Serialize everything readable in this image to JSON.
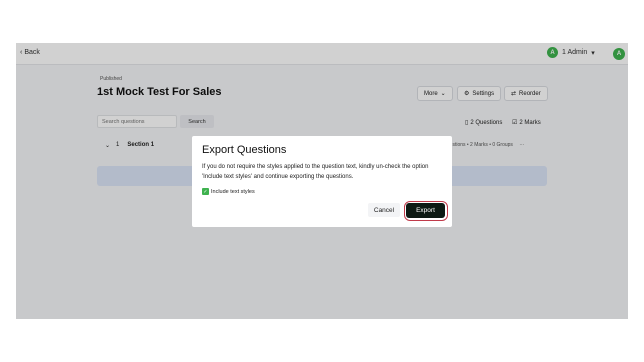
{
  "topbar": {
    "back_label": "Back",
    "user_initial": "A",
    "user_label": "1 Admin",
    "avatar_initial": "A"
  },
  "test": {
    "status": "Published",
    "title": "1st Mock Test For Sales"
  },
  "toolbar": {
    "more_label": "More",
    "settings_label": "Settings",
    "reorder_label": "Reorder"
  },
  "search": {
    "placeholder": "Search questions",
    "button_label": "Search"
  },
  "stats": {
    "questions": "2 Questions",
    "marks": "2 Marks"
  },
  "section": {
    "number": "1",
    "name": "Section 1",
    "meta": "Questions • 2 Marks • 0 Groups"
  },
  "dialog": {
    "title": "Export Questions",
    "body": "If you do not require the styles applied to the question text, kindly un-check the option 'Include text styles' and continue exporting the questions.",
    "checkbox_label": "Include text styles",
    "checkbox_checked": true,
    "cancel_label": "Cancel",
    "export_label": "Export"
  },
  "colors": {
    "accent": "#3fb24f",
    "export_button": "#0d1a14",
    "highlight_ring": "#c03a4a"
  }
}
